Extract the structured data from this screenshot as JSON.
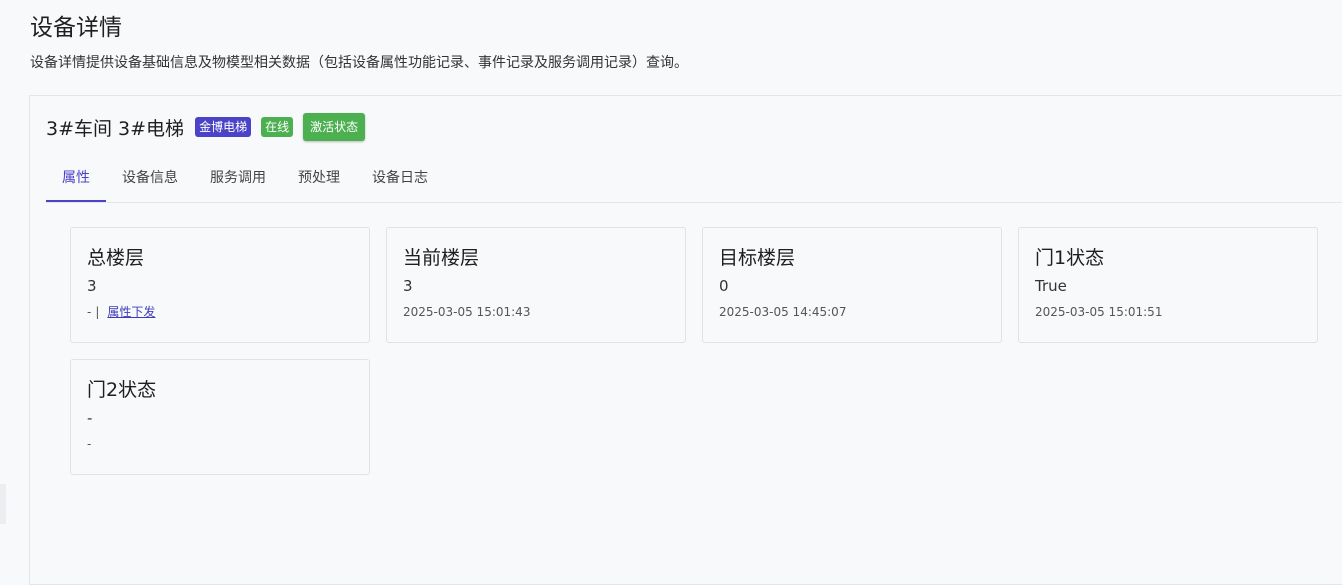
{
  "page": {
    "title": "设备详情",
    "description": "设备详情提供设备基础信息及物模型相关数据（包括设备属性功能记录、事件记录及服务调用记录）查询。"
  },
  "device": {
    "name": "3#车间 3#电梯",
    "brand_badge": "金博电梯",
    "status_badge": "在线",
    "activate_label": "激活状态",
    "colors": {
      "brand": "#4a43c7",
      "online": "#4caf50"
    }
  },
  "tabs": [
    {
      "label": "属性",
      "active": true
    },
    {
      "label": "设备信息",
      "active": false
    },
    {
      "label": "服务调用",
      "active": false
    },
    {
      "label": "预处理",
      "active": false
    },
    {
      "label": "设备日志",
      "active": false
    }
  ],
  "properties": [
    {
      "title": "总楼层",
      "value": "3",
      "sub_prefix": "-",
      "sub_separator": "|",
      "link": "属性下发"
    },
    {
      "title": "当前楼层",
      "value": "3",
      "timestamp": "2025-03-05 15:01:43"
    },
    {
      "title": "目标楼层",
      "value": "0",
      "timestamp": "2025-03-05 14:45:07"
    },
    {
      "title": "门1状态",
      "value": "True",
      "timestamp": "2025-03-05 15:01:51"
    },
    {
      "title": "门2状态",
      "value": "-",
      "timestamp": "-"
    }
  ]
}
